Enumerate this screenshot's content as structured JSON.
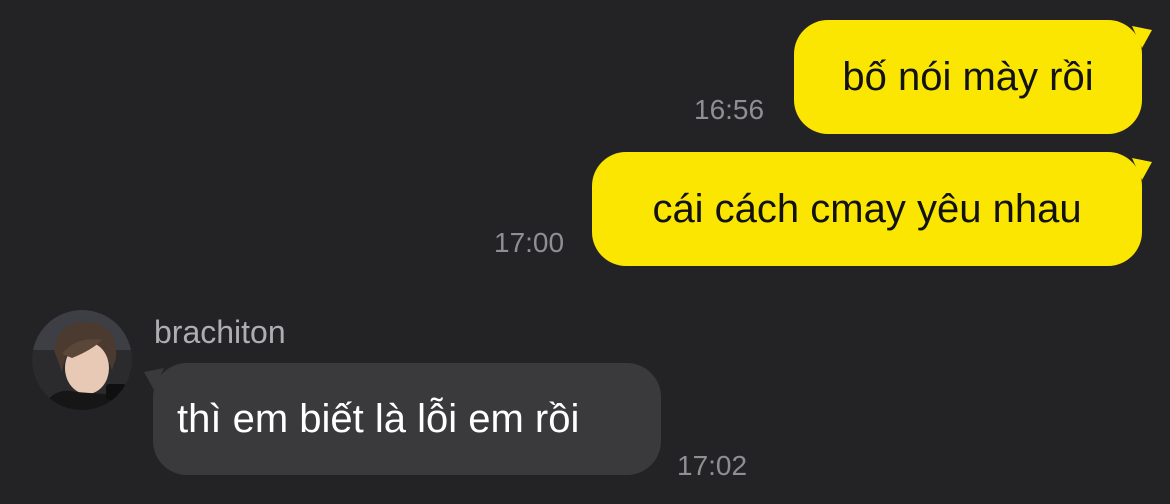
{
  "theme": {
    "background": "#232325",
    "outgoing_bubble": "#fae600",
    "incoming_bubble": "#3a3a3c",
    "timestamp_color": "#8e8e93"
  },
  "messages": [
    {
      "direction": "outgoing",
      "text": "bố nói mày rồi",
      "time": "16:56"
    },
    {
      "direction": "outgoing",
      "text": "cái cách cmay yêu nhau",
      "time": "17:00"
    },
    {
      "direction": "incoming",
      "sender": "brachiton",
      "avatar": "profile-photo",
      "text": "thì em biết là lỗi em rồi",
      "time": "17:02"
    }
  ]
}
